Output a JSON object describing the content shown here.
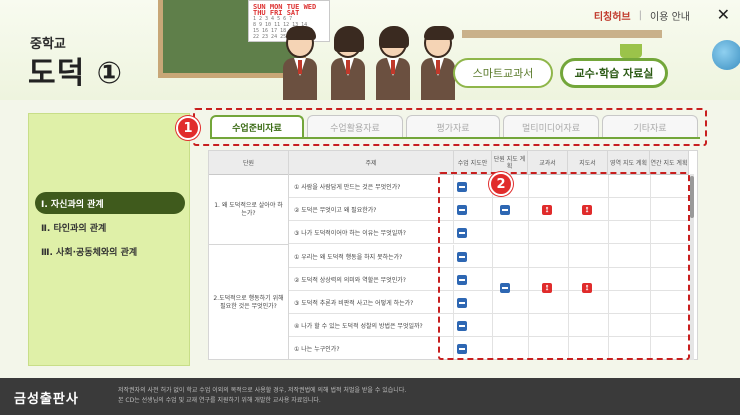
{
  "brand": {
    "subtitle": "중학교",
    "title": "도덕 ①"
  },
  "header_links": {
    "logo": "티칭허브",
    "separator": "|",
    "help": "이용 안내",
    "close_glyph": "✕"
  },
  "header_buttons": {
    "smart_textbook": "스마트교과서",
    "teaching_materials": "교수·학습 자료실"
  },
  "calendar": {
    "head": "SUN MON TUE WED THU FRI SAT",
    "rows": [
      "1 2 3 4 5 6 7",
      "8 9 10 11 12 13 14",
      "15 16 17 18 19 20 21",
      "22 23 24 25 26 27 28"
    ]
  },
  "sidebar": {
    "items": [
      {
        "label": "Ⅰ. 자신과의 관계",
        "active": true
      },
      {
        "label": "Ⅱ. 타인과의 관계",
        "active": false
      },
      {
        "label": "Ⅲ. 사회·공동체와의 관계",
        "active": false
      }
    ]
  },
  "tabs": [
    {
      "label": "수업준비자료",
      "active": true
    },
    {
      "label": "수업활용자료",
      "active": false
    },
    {
      "label": "평가자료",
      "active": false
    },
    {
      "label": "멀티미디어자료",
      "active": false
    },
    {
      "label": "기타자료",
      "active": false
    }
  ],
  "badges": {
    "one": "1",
    "two": "2"
  },
  "table": {
    "headers": [
      "단원",
      "주제",
      "수업 지도안",
      "단원 지도 계획",
      "교과서",
      "지도서",
      "영역 지도 계획",
      "연간 지도 계획"
    ],
    "units": [
      {
        "label": "1. 왜 도덕적으로 살아야 하는가?"
      },
      {
        "label": "2.도덕적으로 행동하기 위해 필요한 것은 무엇인가?"
      }
    ],
    "topics": [
      "① 사람을 사람답게 만드는 것은 무엇인가?",
      "② 도덕은 무엇이고 왜 필요한가?",
      "③ 나가 도덕적이어야 하는 이유는 무엇일까?",
      "① 우리는 왜 도덕적 행동을 하지 못하는가?",
      "② 도덕적 상상력의 의미와 역할은 무엇인가?",
      "③ 도덕적 추론과 비판적 사고는 어떻게 하는가?",
      "④ 나가 할 수 있는 도덕적 성찰의 방법은 무엇일까?",
      "① 나는 누구인가?"
    ]
  },
  "footer": {
    "logo": "금성출판사",
    "line1": "저작권자의 사전 허가 없이 학교 수업 이외의 목적으로 사용할 경우, 저작권법에 의해 법적 처벌을 받을 수 있습니다.",
    "line2": "본 CD는 선생님의 수업 및 교재 연구를 지원하기 위해 개발한 교사용 자료입니다."
  },
  "colors": {
    "accent_green": "#73a63a",
    "active_nav": "#3f5a1c",
    "highlight_red": "#c81f1f",
    "doc_blue": "#2e67b3",
    "pdf_red": "#e02b2b"
  }
}
